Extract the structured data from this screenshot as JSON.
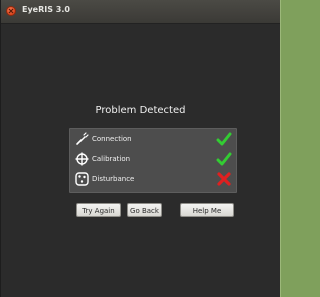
{
  "window": {
    "title": "EyeRIS 3.0"
  },
  "dialog": {
    "heading": "Problem Detected",
    "checks": [
      {
        "label": "Connection",
        "icon": "connection-icon",
        "status": "ok"
      },
      {
        "label": "Calibration",
        "icon": "calibration-icon",
        "status": "ok"
      },
      {
        "label": "Disturbance",
        "icon": "disturbance-icon",
        "status": "error"
      }
    ],
    "buttons": {
      "try_again": "Try Again",
      "go_back": "Go Back",
      "help_me": "Help Me"
    }
  },
  "colors": {
    "ok": "#33cc33",
    "error": "#e02020",
    "background": "#2b2b2b",
    "panel": "#4d4d4d"
  }
}
